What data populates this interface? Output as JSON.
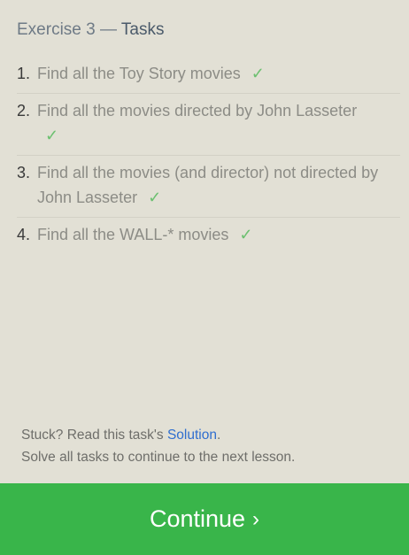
{
  "header": {
    "exercise": "Exercise 3",
    "separator": " — ",
    "tasks_label": "Tasks"
  },
  "tasks": [
    {
      "number": "1.",
      "text": "Find all the Toy Story movies",
      "done": true,
      "check_icon": "checkmark-icon"
    },
    {
      "number": "2.",
      "text": "Find all the movies directed by John Lasseter",
      "done": true,
      "check_icon": "checkmark-icon"
    },
    {
      "number": "3.",
      "text": "Find all the movies (and director) not directed by John Lasseter",
      "done": true,
      "check_icon": "checkmark-icon"
    },
    {
      "number": "4.",
      "text": "Find all the WALL-* movies",
      "done": true,
      "check_icon": "checkmark-icon"
    }
  ],
  "check_glyph": "✓",
  "footer": {
    "stuck_prefix": "Stuck? Read this task's ",
    "solution_link": "Solution",
    "stuck_suffix": ".",
    "instruction": "Solve all tasks to continue to the next lesson."
  },
  "continue_button": {
    "label": "Continue",
    "chevron": "›"
  },
  "colors": {
    "background": "#e2e0d5",
    "accent_green": "#39b54a",
    "check_green": "#6cc070",
    "link_blue": "#2f6ecf"
  }
}
